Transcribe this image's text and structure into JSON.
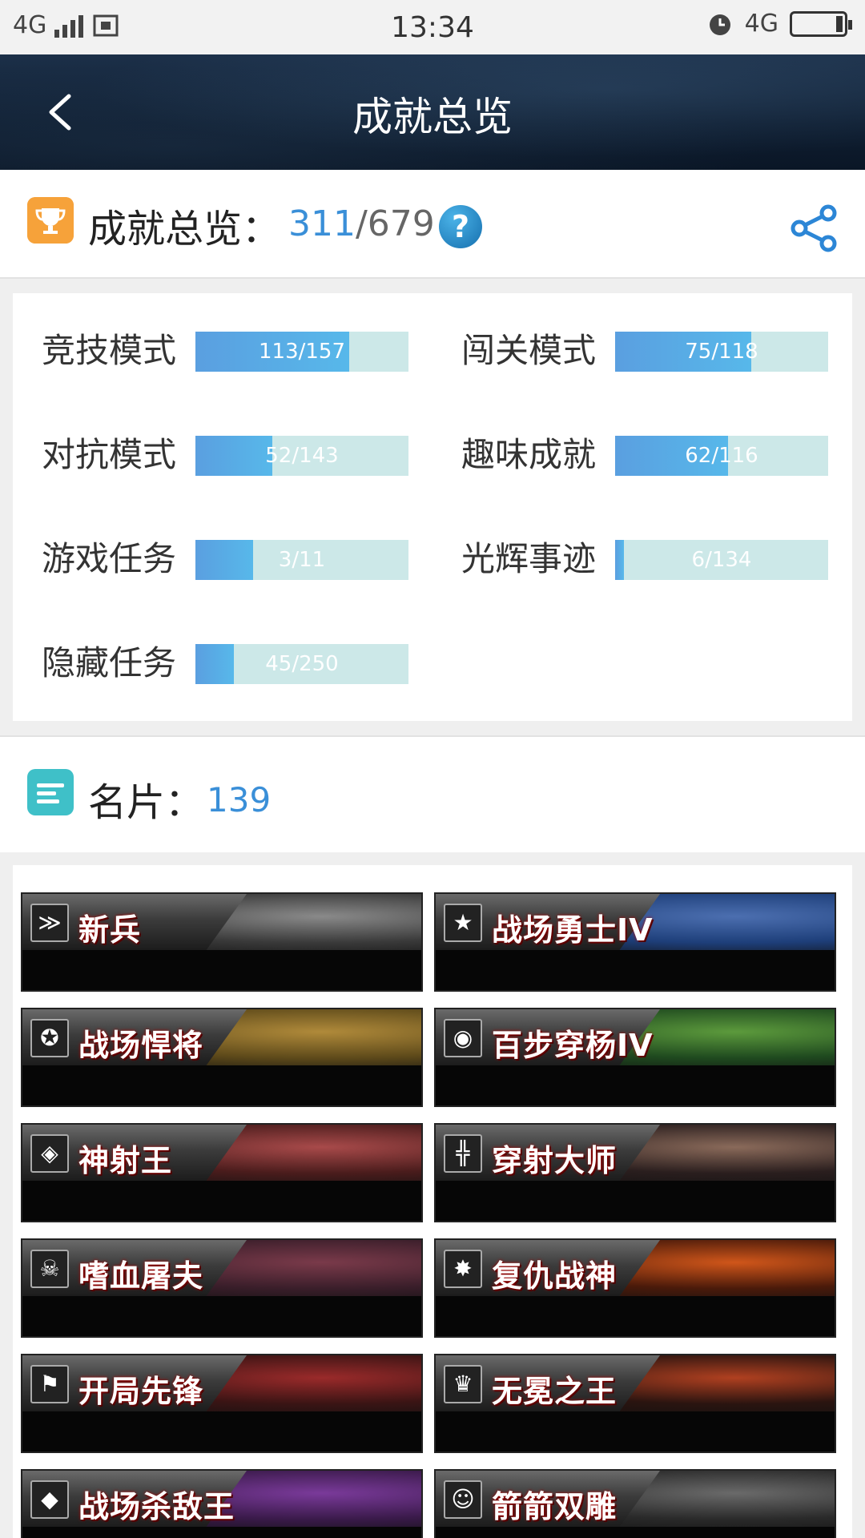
{
  "status_bar": {
    "network_left": "4G",
    "time": "13:34",
    "network_right": "4G"
  },
  "header": {
    "title": "成就总览"
  },
  "summary": {
    "label": "成就总览：",
    "achieved": "311",
    "total": "/679",
    "help_label": "?"
  },
  "categories": [
    {
      "label": "竞技模式",
      "text": "113/157",
      "fraction": 0.72
    },
    {
      "label": "闯关模式",
      "text": "75/118",
      "fraction": 0.64
    },
    {
      "label": "对抗模式",
      "text": "52/143",
      "fraction": 0.36
    },
    {
      "label": "趣味成就",
      "text": "62/116",
      "fraction": 0.53
    },
    {
      "label": "游戏任务",
      "text": "3/11",
      "fraction": 0.27
    },
    {
      "label": "光辉事迹",
      "text": "6/134",
      "fraction": 0.04
    },
    {
      "label": "隐藏任务",
      "text": "45/250",
      "fraction": 0.18
    }
  ],
  "name_cards": {
    "label": "名片：",
    "count": "139",
    "cards": [
      {
        "title": "新兵",
        "badge": "≫",
        "bg": "#3a3a3a",
        "accent": "#8a8a8a"
      },
      {
        "title": "战场勇士IV",
        "badge": "★",
        "bg": "#1e3f7a",
        "accent": "#4c6fb0"
      },
      {
        "title": "战场悍将",
        "badge": "✪",
        "bg": "#5e4a1a",
        "accent": "#b08a3a"
      },
      {
        "title": "百步穿杨IV",
        "badge": "◉",
        "bg": "#1f4a1f",
        "accent": "#5c9a3c"
      },
      {
        "title": "神射王",
        "badge": "◈",
        "bg": "#4a1c1c",
        "accent": "#a84a4a"
      },
      {
        "title": "穿射大师",
        "badge": "╬",
        "bg": "#2a1e1e",
        "accent": "#8a6a5a"
      },
      {
        "title": "嗜血屠夫",
        "badge": "☠",
        "bg": "#3a1e2a",
        "accent": "#7a3a4a"
      },
      {
        "title": "复仇战神",
        "badge": "✸",
        "bg": "#4a1a0a",
        "accent": "#d0561a"
      },
      {
        "title": "开局先锋",
        "badge": "⚑",
        "bg": "#3a1414",
        "accent": "#9a2a2a"
      },
      {
        "title": "无冕之王",
        "badge": "♛",
        "bg": "#2a1410",
        "accent": "#b04020"
      },
      {
        "title": "战场杀敌王",
        "badge": "◆",
        "bg": "#3a1a4a",
        "accent": "#7a3a9a"
      },
      {
        "title": "箭箭双雕",
        "badge": "☺",
        "bg": "#2a2a2a",
        "accent": "#6a6a6a"
      }
    ]
  }
}
